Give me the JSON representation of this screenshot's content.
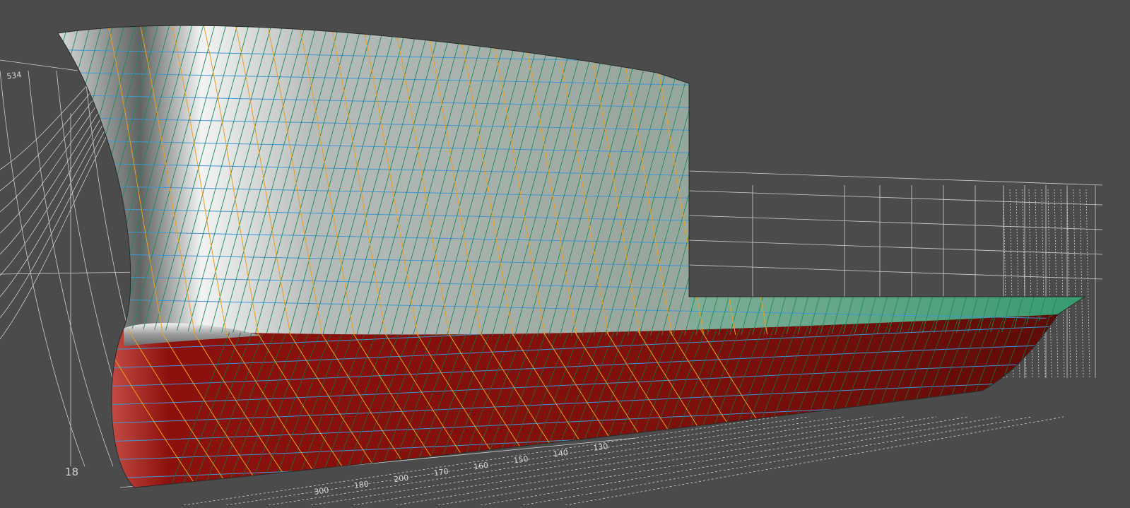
{
  "viewport": {
    "background": "#4b4b4b",
    "hull_upper_color": "#8fa394",
    "hull_lower_color": "#8a0f0a",
    "waterline_color": "#3f96d8",
    "buttock_color": "#1e8a5a",
    "station_color": "#e8a01e",
    "wire_color": "#e6e6e6"
  },
  "labels": {
    "corner_label": "534",
    "station_left": "18",
    "scale": [
      "300",
      "180",
      "200",
      "170",
      "160",
      "150",
      "140",
      "130"
    ]
  }
}
